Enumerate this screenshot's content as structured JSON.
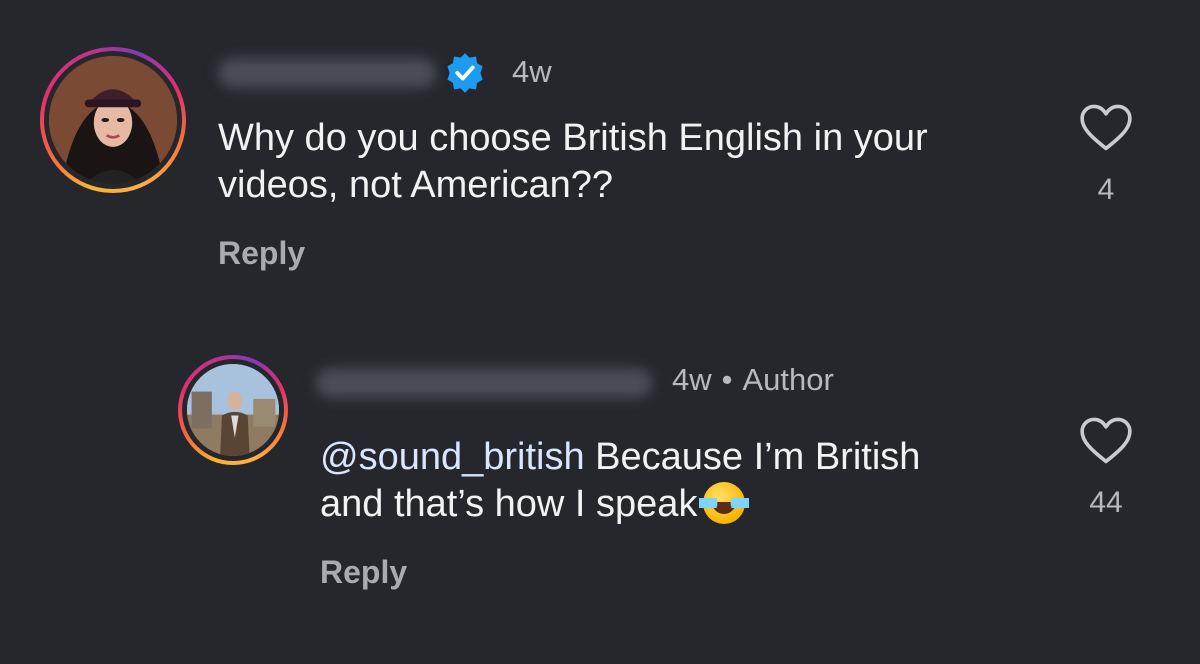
{
  "comments": [
    {
      "time": "4w",
      "text": "Why do you choose British English in your videos, not American??",
      "reply_label": "Reply",
      "likes": "4",
      "verified": true,
      "icons": {
        "verified": "verified-badge-icon",
        "like": "heart-icon"
      }
    },
    {
      "time": "4w",
      "separator": "•",
      "author_tag": "Author",
      "mention": "@sound_british",
      "text_line1": " Because I’m British",
      "text_line2": "and that’s how I speak",
      "emoji": "face-with-tears-of-joy-icon",
      "reply_label": "Reply",
      "likes": "44",
      "icons": {
        "like": "heart-icon"
      }
    }
  ],
  "colors": {
    "background": "#25272c",
    "verified": "#1d9bf0",
    "mention": "#d8e6ff",
    "muted": "#b7b9be"
  }
}
